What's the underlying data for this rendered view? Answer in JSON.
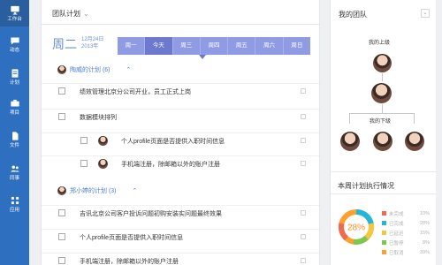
{
  "sidebar": {
    "items": [
      {
        "label": "工作台",
        "icon": "desktop-icon"
      },
      {
        "label": "动态",
        "icon": "chat-icon"
      },
      {
        "label": "计划",
        "icon": "plan-icon"
      },
      {
        "label": "项目",
        "icon": "briefcase-icon"
      },
      {
        "label": "文件",
        "icon": "file-icon"
      },
      {
        "label": "同事",
        "icon": "people-icon"
      },
      {
        "label": "应用",
        "icon": "apps-icon"
      }
    ]
  },
  "main": {
    "title": "团队计划",
    "weekday": "周二",
    "date_line1": "12月24日",
    "date_line2": "2013年",
    "days": [
      "周一",
      "今天",
      "周三",
      "周四",
      "周五",
      "周六",
      "周日"
    ],
    "groups": [
      {
        "title": "陶威的计划 (6)",
        "tasks": [
          {
            "text": "绩效管理北京分公司开业，员工正式上岗"
          },
          {
            "text": "数据模块排列"
          },
          {
            "text": "个人profile页面是否提供入职时间信息"
          },
          {
            "text": "手机端注册，除邮箱以外的账户注册"
          }
        ]
      },
      {
        "title": "郑小婷的计划 (3)",
        "tasks": [
          {
            "text": "吉讯北京公司客户投诉问题初购安装实问题最终效果"
          },
          {
            "text": "个人profile页面是否提供入职时间信息"
          },
          {
            "text": "手机端注册，除邮箱以外的账户注册"
          }
        ]
      }
    ]
  },
  "right": {
    "title": "我的团队",
    "superior_label": "我的上级",
    "subordinate_label": "我的下级",
    "stats_title": "本周计划执行情况",
    "percent": "28%",
    "legend": [
      {
        "label": "未完成",
        "value": "10%",
        "color": "#ef6b50"
      },
      {
        "label": "已完成",
        "value": "28%",
        "color": "#22b7d9"
      },
      {
        "label": "已延迟",
        "value": "15%",
        "color": "#f3c83d"
      },
      {
        "label": "已暂停",
        "value": "8%",
        "color": "#77c952"
      },
      {
        "label": "已取消",
        "value": "39%",
        "color": "#ff9f2e"
      }
    ]
  }
}
